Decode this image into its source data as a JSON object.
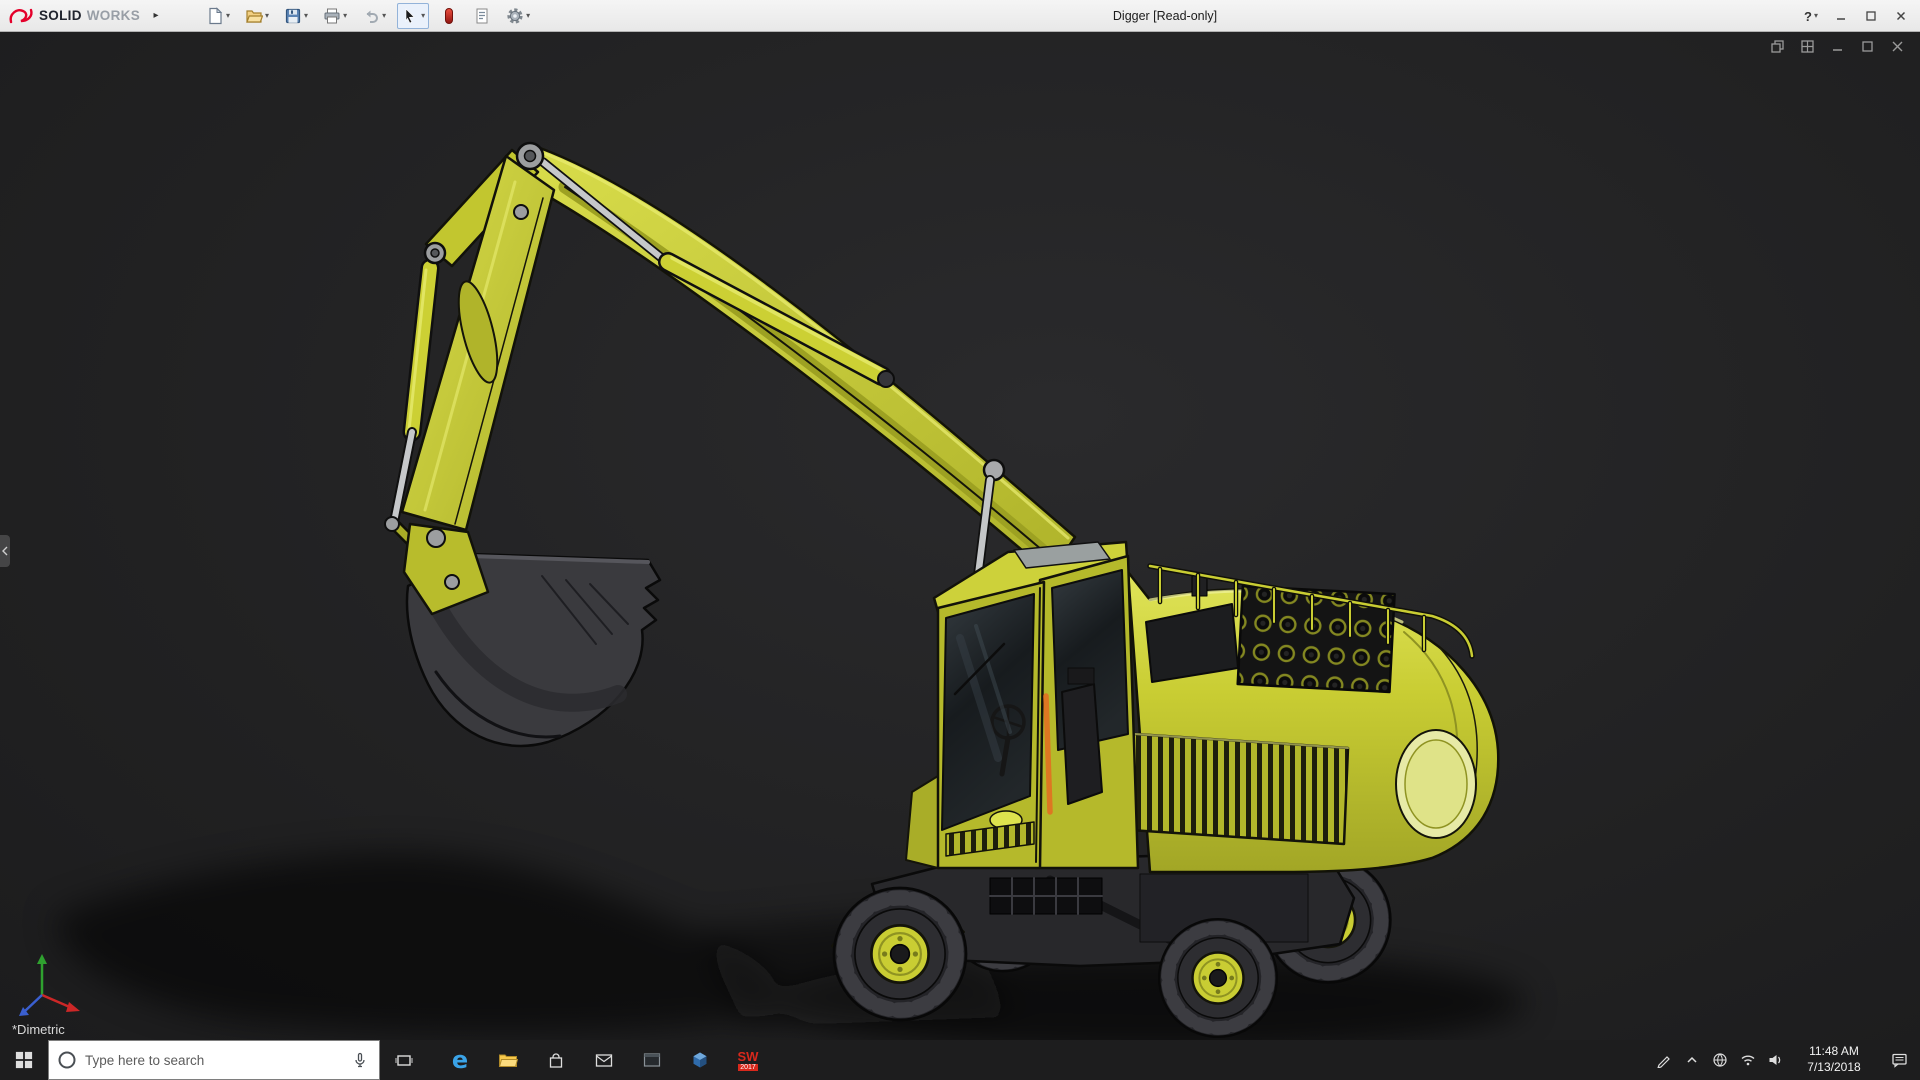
{
  "titlebar": {
    "brand": {
      "part1": "SOLID",
      "part2": "WORKS"
    },
    "expand_glyph": "▸",
    "document_title": "Digger [Read-only]",
    "help_label": "?"
  },
  "toolbar": {
    "dropdown_glyph": "▾",
    "buttons": [
      {
        "name": "new-document"
      },
      {
        "name": "open"
      },
      {
        "name": "save"
      },
      {
        "name": "print"
      },
      {
        "name": "undo"
      },
      {
        "name": "select"
      },
      {
        "name": "rebuild"
      },
      {
        "name": "file-properties"
      },
      {
        "name": "options"
      }
    ]
  },
  "viewport": {
    "view_label": "*Dimetric",
    "model_name": "Digger",
    "colors": {
      "body_yellow": "#c9cd33",
      "bucket_gray": "#3a3a3e",
      "glass": "#1b2023",
      "accent_orange": "#dd7722",
      "background": "#222224"
    }
  },
  "taskbar": {
    "search": {
      "placeholder": "Type here to search"
    },
    "apps": [
      {
        "name": "task-view"
      },
      {
        "name": "edge",
        "glyph": "e"
      },
      {
        "name": "file-explorer"
      },
      {
        "name": "store"
      },
      {
        "name": "mail"
      },
      {
        "name": "console-app"
      },
      {
        "name": "edrawings"
      },
      {
        "name": "solidworks-2017",
        "label": "SW",
        "sublabel": "2017"
      }
    ],
    "clock": {
      "time": "11:48 AM",
      "date": "7/13/2018"
    }
  }
}
